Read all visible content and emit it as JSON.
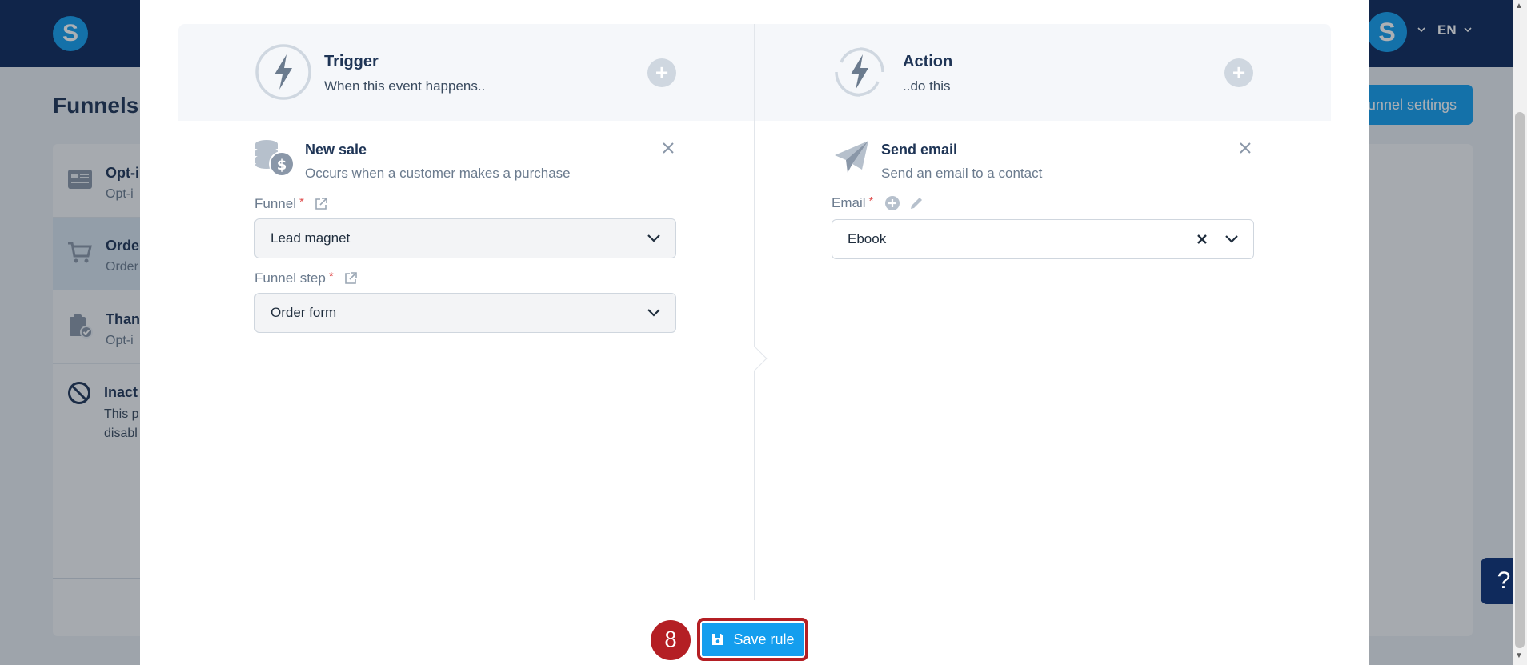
{
  "app": {
    "logo_letter": "S",
    "user_initial": "S",
    "language": "EN",
    "page_title": "Funnels",
    "settings_button": "unnel settings"
  },
  "background_list": [
    {
      "title": "Opt-i",
      "subtitle": "Opt-i",
      "icon": "form-icon",
      "active": false
    },
    {
      "title": "Orde",
      "subtitle": "Order",
      "icon": "cart-icon",
      "active": true
    },
    {
      "title": "Than",
      "subtitle": "Opt-i",
      "icon": "clipboard-check-icon",
      "active": false
    }
  ],
  "inactive": {
    "title": "Inact",
    "desc_line1": "This p",
    "desc_line2": "disabl"
  },
  "help_label": "?",
  "modal": {
    "trigger_header": {
      "title": "Trigger",
      "subtitle": "When this event happens.."
    },
    "action_header": {
      "title": "Action",
      "subtitle": "..do this"
    },
    "trigger": {
      "title": "New sale",
      "subtitle": "Occurs when a customer makes a purchase",
      "funnel_label": "Funnel",
      "funnel_value": "Lead magnet",
      "step_label": "Funnel step",
      "step_value": "Order form"
    },
    "action": {
      "title": "Send email",
      "subtitle": "Send an email to a contact",
      "email_label": "Email",
      "email_value": "Ebook"
    },
    "required_mark": "*",
    "step_number": "8",
    "save_label": "Save rule"
  },
  "colors": {
    "topbar": "#0f2a5c",
    "brand_blue": "#149eee",
    "highlight_red": "#b41f24",
    "required": "#e05252"
  }
}
